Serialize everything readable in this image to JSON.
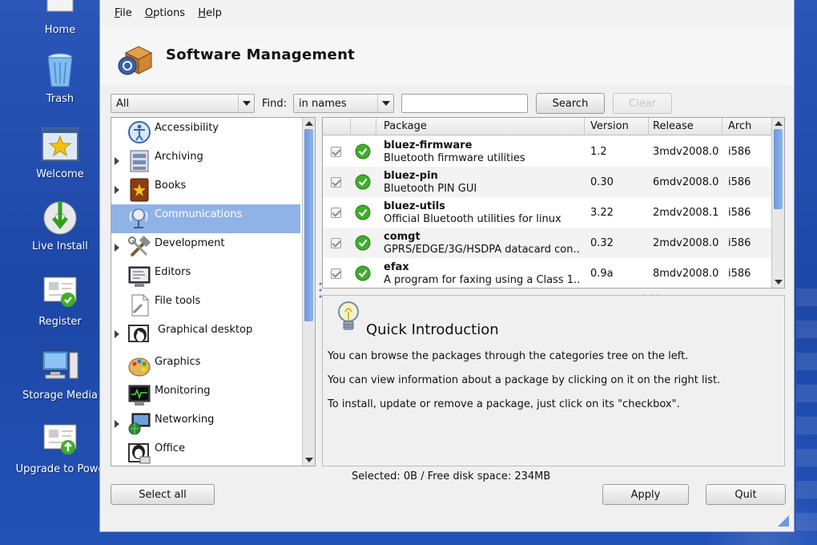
{
  "desktop": {
    "icons": [
      {
        "label": "Home"
      },
      {
        "label": "Trash"
      },
      {
        "label": "Welcome"
      },
      {
        "label": "Live Install"
      },
      {
        "label": "Register"
      },
      {
        "label": "Storage Media"
      },
      {
        "label": "Upgrade to Powe"
      }
    ]
  },
  "menu": {
    "file": "File",
    "options": "Options",
    "help": "Help"
  },
  "header": {
    "title": "Software Management"
  },
  "toolbar": {
    "filter_value": "All",
    "find_label": "Find:",
    "find_in_value": "in names",
    "search_value": "",
    "search_button": "Search",
    "clear_button": "Clear"
  },
  "categories": [
    {
      "label": "Accessibility",
      "expandable": false,
      "selected": false
    },
    {
      "label": "Archiving",
      "expandable": true,
      "selected": false
    },
    {
      "label": "Books",
      "expandable": true,
      "selected": false
    },
    {
      "label": "Communications",
      "expandable": false,
      "selected": true
    },
    {
      "label": "Development",
      "expandable": true,
      "selected": false
    },
    {
      "label": "Editors",
      "expandable": false,
      "selected": false
    },
    {
      "label": "File tools",
      "expandable": false,
      "selected": false
    },
    {
      "label": "Graphical desktop",
      "expandable": true,
      "selected": false
    },
    {
      "label": "Graphics",
      "expandable": false,
      "selected": false
    },
    {
      "label": "Monitoring",
      "expandable": false,
      "selected": false
    },
    {
      "label": "Networking",
      "expandable": true,
      "selected": false
    },
    {
      "label": "Office",
      "expandable": false,
      "selected": false
    }
  ],
  "package_list": {
    "columns": {
      "package": "Package",
      "version": "Version",
      "release": "Release",
      "arch": "Arch"
    },
    "rows": [
      {
        "name": "bluez-firmware",
        "desc": "Bluetooth firmware utilities",
        "version": "1.2",
        "release": "3mdv2008.0",
        "arch": "i586"
      },
      {
        "name": "bluez-pin",
        "desc": "Bluetooth PIN GUI",
        "version": "0.30",
        "release": "6mdv2008.0",
        "arch": "i586"
      },
      {
        "name": "bluez-utils",
        "desc": "Official Bluetooth utilities for linux",
        "version": "3.22",
        "release": "2mdv2008.1",
        "arch": "i586"
      },
      {
        "name": "comgt",
        "desc": "GPRS/EDGE/3G/HSDPA datacard con...",
        "version": "0.32",
        "release": "2mdv2008.0",
        "arch": "i586"
      },
      {
        "name": "efax",
        "desc": "A program for faxing using a Class 1...",
        "version": "0.9a",
        "release": "8mdv2008.0",
        "arch": "i586"
      }
    ]
  },
  "info": {
    "title": "Quick Introduction",
    "lines": [
      "You can browse the packages through the categories tree on the left.",
      "You can view information about a package by clicking on it on the right list.",
      "To install, update or remove a package, just click on its \"checkbox\"."
    ]
  },
  "status": {
    "text": "Selected: 0B / Free disk space: 234MB"
  },
  "buttons": {
    "select_all": "Select all",
    "apply": "Apply",
    "quit": "Quit"
  },
  "colors": {
    "selection": "#8fb3e6",
    "desktop": "#2a56b8",
    "status_ok": "#3fae2a"
  }
}
